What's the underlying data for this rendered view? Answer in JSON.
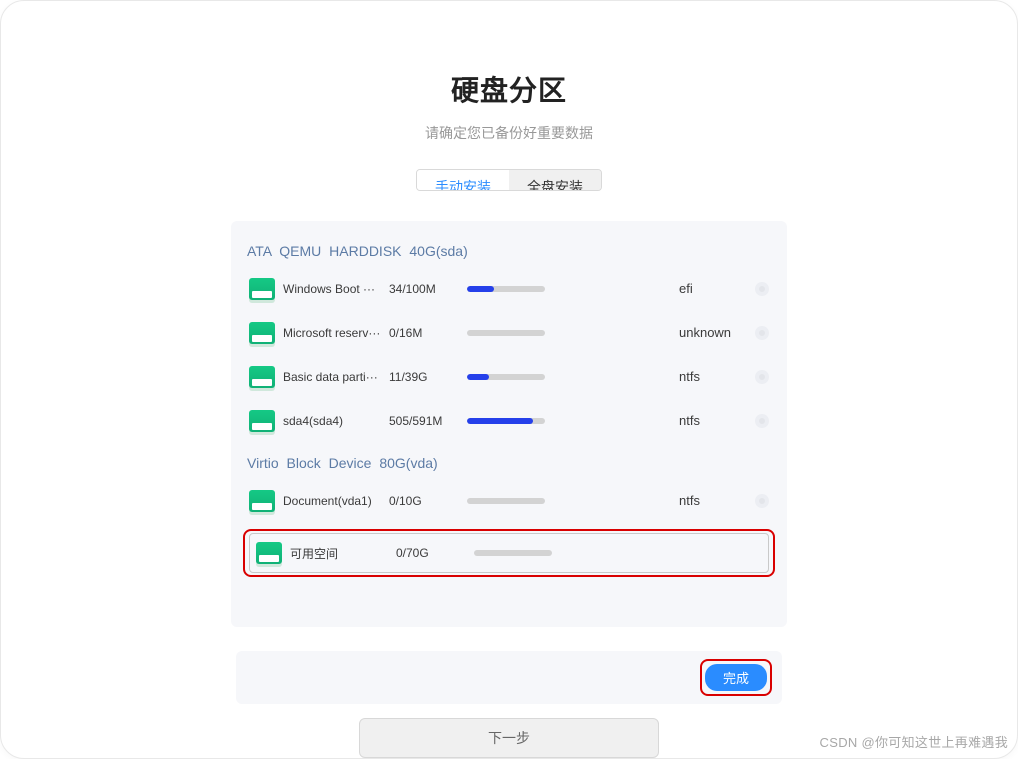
{
  "header": {
    "title": "硬盘分区",
    "subtitle": "请确定您已备份好重要数据"
  },
  "tabs": {
    "manual": "手动安装",
    "full": "全盘安装"
  },
  "groups": [
    {
      "title": "ATA QEMU HARDDISK 40G(sda)",
      "items": [
        {
          "name": "Windows Boot ···",
          "size": "34/100M",
          "fill": 34,
          "fs": "efi",
          "editable": true
        },
        {
          "name": "Microsoft reserv···",
          "size": "0/16M",
          "fill": 0,
          "fs": "unknown",
          "editable": true
        },
        {
          "name": "Basic data parti···",
          "size": "11/39G",
          "fill": 28,
          "fs": "ntfs",
          "editable": true
        },
        {
          "name": "sda4(sda4)",
          "size": "505/591M",
          "fill": 85,
          "fs": "ntfs",
          "editable": true
        }
      ]
    },
    {
      "title": "Virtio Block Device 80G(vda)",
      "items": [
        {
          "name": "Document(vda1)",
          "size": "0/10G",
          "fill": 0,
          "fs": "ntfs",
          "editable": true
        }
      ],
      "free": {
        "name": "可用空间",
        "size": "0/70G",
        "fill": 0
      }
    }
  ],
  "buttons": {
    "done": "完成",
    "next": "下一步"
  },
  "watermark": "CSDN @你可知这世上再难遇我"
}
